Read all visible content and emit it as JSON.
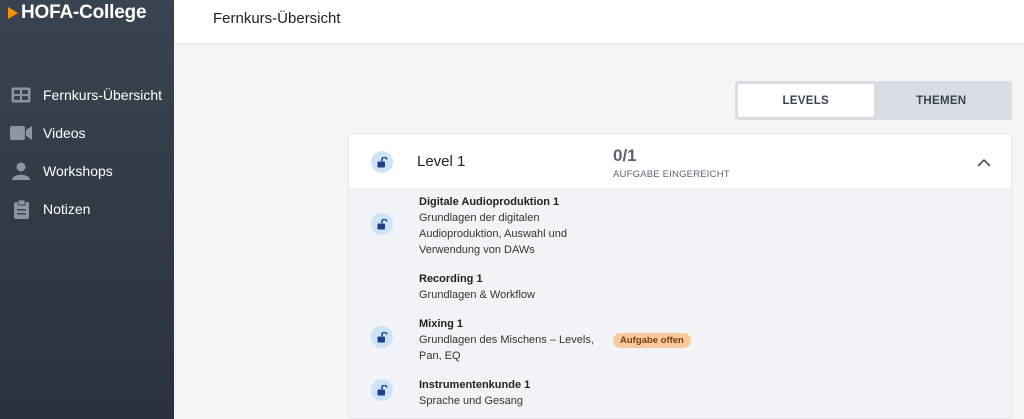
{
  "app": {
    "logo_text": "HOFA-College",
    "brand_color": "#f39200"
  },
  "sidebar": {
    "items": [
      {
        "label": "Fernkurs-Übersicht",
        "icon": "dashboard-icon"
      },
      {
        "label": "Videos",
        "icon": "video-camera-icon"
      },
      {
        "label": "Workshops",
        "icon": "user-icon"
      },
      {
        "label": "Notizen",
        "icon": "clipboard-icon"
      }
    ]
  },
  "header": {
    "title": "Fernkurs-Übersicht"
  },
  "view_toggle": {
    "options": [
      "LEVELS",
      "THEMEN"
    ],
    "selected": "LEVELS"
  },
  "level": {
    "title": "Level 1",
    "progress": "0/1",
    "progress_label": "AUFGABE EINGEREICHT",
    "expanded": true,
    "lessons": [
      {
        "title": "Digitale Audioproduktion 1",
        "desc": "Grundlagen der digitalen Audioproduktion, Auswahl und Verwendung von DAWs"
      },
      {
        "title": "Recording 1",
        "desc": "Grundlagen & Workflow"
      },
      {
        "title": "Mixing 1",
        "desc": "Grundlagen des Mischens – Levels, Pan, EQ",
        "badge": "Aufgabe offen"
      },
      {
        "title": "Instrumentenkunde 1",
        "desc": "Sprache und Gesang"
      }
    ]
  }
}
